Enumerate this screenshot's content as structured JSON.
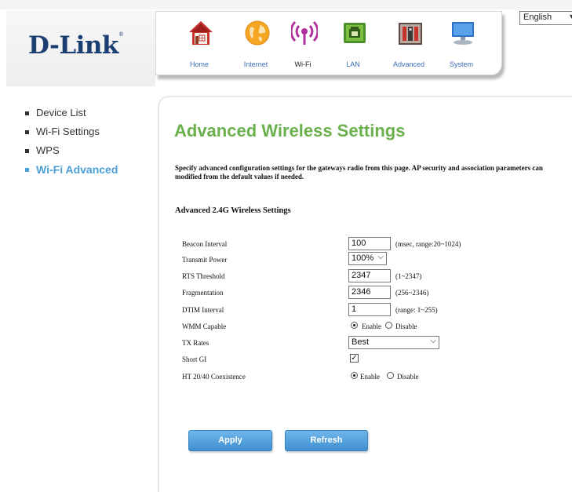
{
  "header": {
    "logo_text": "D-Link",
    "logo_mark": "®",
    "language": {
      "selected": "English"
    },
    "nav_tabs": [
      {
        "label": "Home",
        "icon": "home-icon",
        "active": false
      },
      {
        "label": "Internet",
        "icon": "internet-globe-icon",
        "active": false
      },
      {
        "label": "Wi-Fi",
        "icon": "wifi-icon",
        "active": true
      },
      {
        "label": "LAN",
        "icon": "lan-port-icon",
        "active": false
      },
      {
        "label": "Advanced",
        "icon": "advanced-tools-icon",
        "active": false
      },
      {
        "label": "System",
        "icon": "system-monitor-icon",
        "active": false
      }
    ]
  },
  "sidebar": {
    "items": [
      {
        "label": "Device List",
        "active": false
      },
      {
        "label": "Wi-Fi Settings",
        "active": false
      },
      {
        "label": "WPS",
        "active": false
      },
      {
        "label": "Wi-Fi Advanced",
        "active": true
      }
    ]
  },
  "main": {
    "title": "Advanced Wireless Settings",
    "description_line1": "Specify advanced configuration settings for the gateways radio from this page. AP security and association parameters can",
    "description_line2": "modified from the default values if needed.",
    "section_title": "Advanced 2.4G Wireless Settings",
    "fields": {
      "beacon_interval": {
        "label": "Beacon Interval",
        "value": "100",
        "hint": "(msec, range:20~1024)"
      },
      "transmit_power": {
        "label": "Transmit Power",
        "value": "100%"
      },
      "rts_threshold": {
        "label": "RTS Threshold",
        "value": "2347",
        "hint": "(1~2347)"
      },
      "fragmentation": {
        "label": "Fragmentation",
        "value": "2346",
        "hint": "(256~2346)"
      },
      "dtim_interval": {
        "label": "DTIM Interval",
        "value": "1",
        "hint": "(range: 1~255)"
      },
      "wmm_capable": {
        "label": "WMM Capable",
        "enable_label": "Enable",
        "disable_label": "Disable",
        "selected": "Enable"
      },
      "tx_rates": {
        "label": "TX Rates",
        "value": "Best"
      },
      "short_gi": {
        "label": "Short GI",
        "checked": true
      },
      "ht_coexistence": {
        "label": "HT 20/40 Coexistence",
        "enable_label": "Enable",
        "disable_label": "Disable",
        "selected": "Enable"
      }
    },
    "buttons": {
      "apply": "Apply",
      "refresh": "Refresh"
    }
  },
  "colors": {
    "brand_blue": "#1b3f73",
    "title_green": "#6ab04c",
    "sidebar_active": "#4a9fd8",
    "button_blue": "#4a9bd9",
    "nav_label_blue": "#3c6fb6"
  }
}
